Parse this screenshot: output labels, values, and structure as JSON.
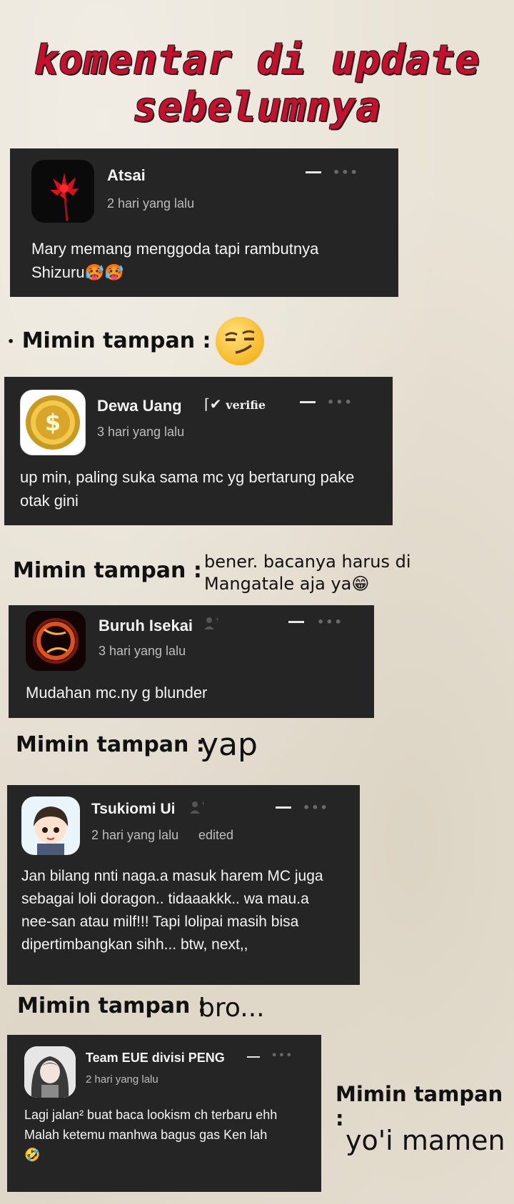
{
  "header": {
    "line1": "komentar di update",
    "line2": "sebelumnya"
  },
  "comments": [
    {
      "username": "Atsai",
      "time": "2 hari yang lalu",
      "text": "Mary memang menggoda tapi rambutnya Shizuru🥵🥵",
      "avatar": "red-spider-lily-avatar"
    },
    {
      "username": "Dewa Uang",
      "badge": "verifie",
      "time": "3 hari yang lalu",
      "text": "up min, paling suka sama mc yg bertarung pake otak gini",
      "avatar": "gold-coin-avatar"
    },
    {
      "username": "Buruh Isekai",
      "time": "3 hari yang lalu",
      "text": "Mudahan mc.ny g blunder",
      "avatar": "fire-ring-avatar"
    },
    {
      "username": "Tsukiomi Ui",
      "time": "2 hari yang lalu",
      "edited": "edited",
      "text": "Jan bilang nnti naga.a masuk harem MC juga sebagai loli doragon.. tidaaakkk.. wa mau.a nee-san atau milf!!! Tapi lolipai masih bisa dipertimbangkan sihh... btw, next,,",
      "avatar": "anime-boy-avatar"
    },
    {
      "username": "Team EUE divisi PENG",
      "time": "2 hari yang lalu",
      "text_line1": "Lagi jalan² buat baca lookism ch terbaru ehh",
      "text_line2": "Malah ketemu manhwa bagus gas Ken lah",
      "text_line3": "🤣",
      "avatar": "anime-girl-avatar"
    }
  ],
  "replies": [
    {
      "label": "Mimin tampan :",
      "text": ""
    },
    {
      "label": "Mimin tampan :",
      "text_line1": "bener. bacanya harus di",
      "text_line2": "Mangatale aja ya😁"
    },
    {
      "label": "Mimin tampan :",
      "text": "yap"
    },
    {
      "label": "Mimin tampan :",
      "text": "bro..."
    },
    {
      "label": "Mimin tampan :",
      "text": "yo'i mamen"
    }
  ],
  "colors": {
    "title": "#c8102e",
    "card": "#252525",
    "page": "#e9e3d6"
  }
}
